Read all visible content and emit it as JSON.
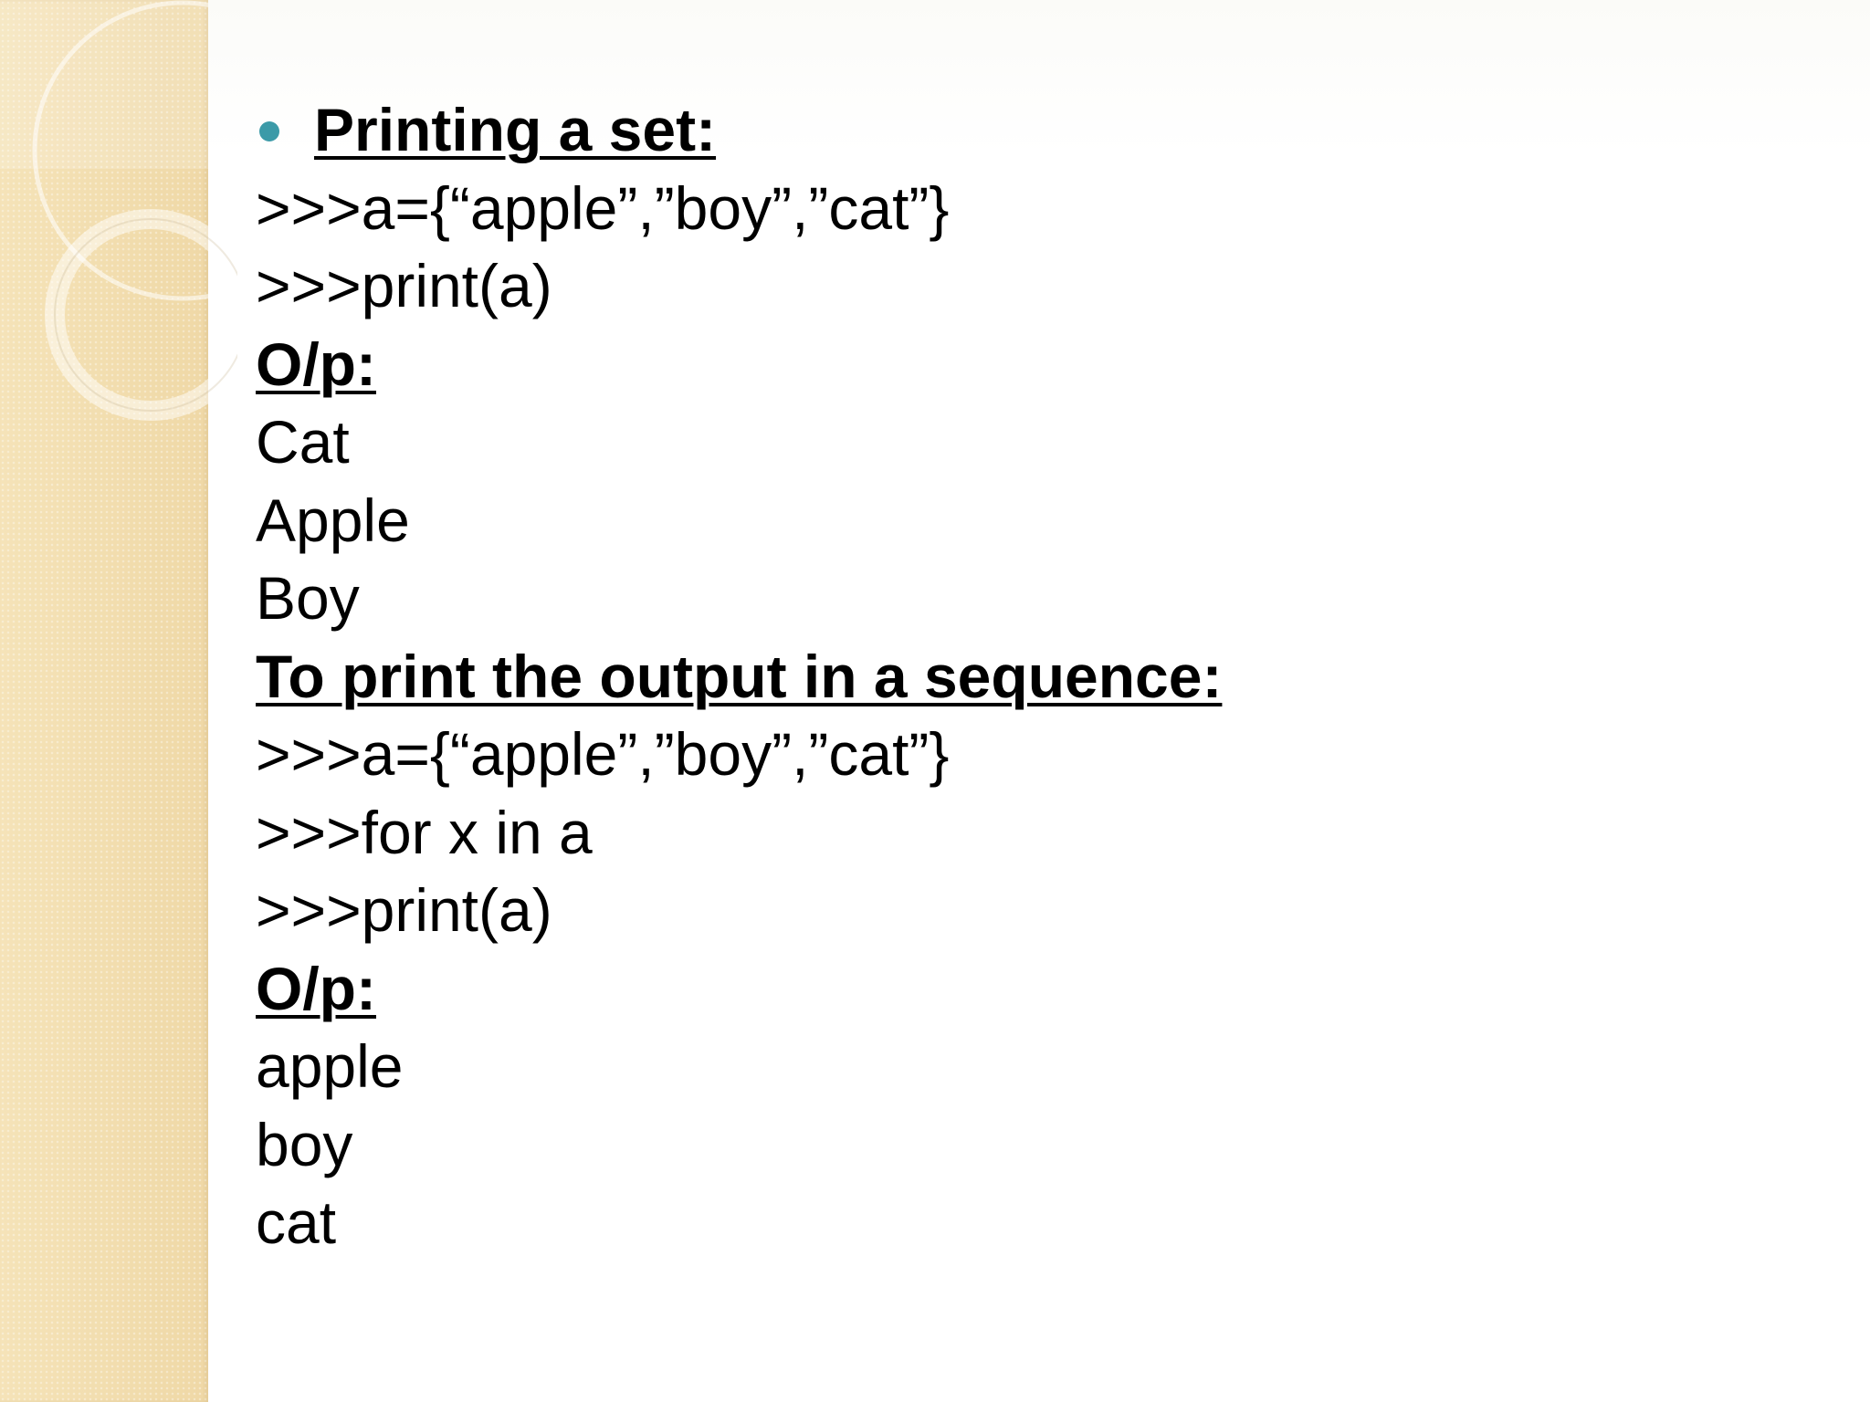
{
  "slide": {
    "heading": "Printing a set:",
    "lines": [
      ">>>a={“apple”,”boy”,”cat”}",
      ">>>print(a)"
    ],
    "output_label_1": "O/p:",
    "output_1": [
      "Cat",
      "Apple",
      "Boy"
    ],
    "subheading": "To print the output in a sequence:",
    "lines_2": [
      ">>>a={“apple”,”boy”,”cat”}",
      ">>>for x in a",
      ">>>print(a)"
    ],
    "output_label_2": "O/p:",
    "output_2": [
      "apple",
      "boy",
      "cat"
    ]
  },
  "colors": {
    "bullet": "#3c9aa8",
    "side_panel": "#f3deb0",
    "text": "#000000"
  }
}
